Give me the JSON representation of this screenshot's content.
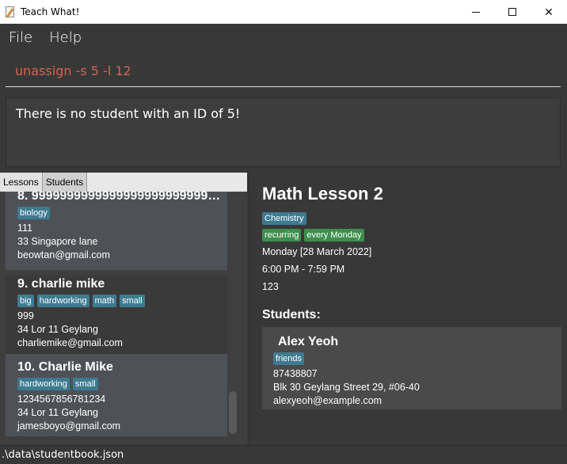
{
  "window": {
    "title": "Teach What!"
  },
  "menu": {
    "file": "File",
    "help": "Help"
  },
  "command": {
    "value": "unassign -s 5 -l 12"
  },
  "result": {
    "text": "There is no student with an ID of 5!"
  },
  "tabs": [
    {
      "label": "Lessons"
    },
    {
      "label": "Students"
    }
  ],
  "students": [
    {
      "title": "8.  99999999999999999999999999999...",
      "tags": [
        "biology"
      ],
      "phone": "111",
      "address": "33 Singapore lane",
      "email": "beowtan@gmail.com"
    },
    {
      "title": "9.  charlie mike",
      "tags": [
        "big",
        "hardworking",
        "math",
        "small"
      ],
      "phone": "999",
      "address": "34 Lor 11 Geylang",
      "email": "charliemike@gmail.com"
    },
    {
      "title": "10.  Charlie Mike",
      "tags": [
        "hardworking",
        "small"
      ],
      "phone": "1234567856781234",
      "address": "34 Lor 11 Geylang",
      "email": "jamesboyo@gmail.com"
    }
  ],
  "lesson": {
    "title": "Math Lesson 2",
    "subject_tag": "Chemistry",
    "type_tags": [
      "recurring",
      "every Monday"
    ],
    "date": "Monday [28 March 2022]",
    "time": "6:00 PM - 7:59 PM",
    "address": "123",
    "students_label": "Students:",
    "student": {
      "name": "Alex Yeoh",
      "tag": "friends",
      "phone": "87438807",
      "address": "Blk 30 Geylang Street 29, #06-40",
      "email": "alexyeoh@example.com"
    }
  },
  "status": {
    "path": ".\\data\\studentbook.json"
  },
  "colors": {
    "accent_tag": "#3e7b91",
    "green_tag": "#3e8f4c",
    "command_text": "#d06651",
    "background": "#383838"
  }
}
